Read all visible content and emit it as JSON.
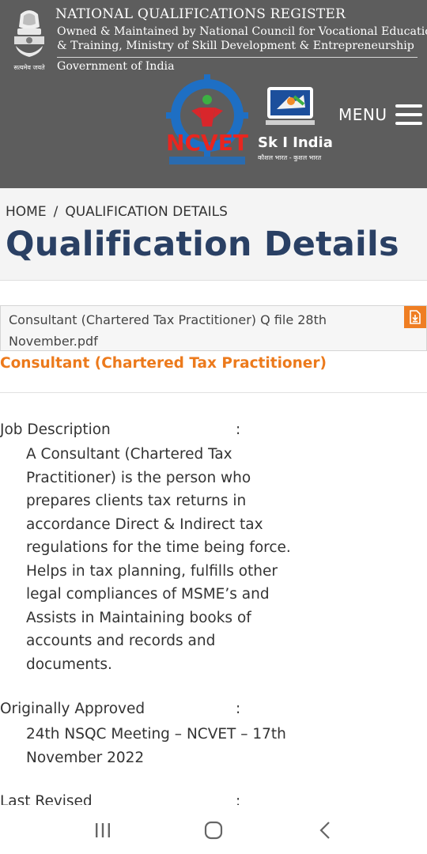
{
  "header": {
    "title": "NATIONAL QUALIFICATIONS REGISTER",
    "subtitle_line1": "Owned & Maintained by National Council for Vocational Education",
    "subtitle_line2": "& Training, Ministry of Skill Development & Entrepreneurship",
    "government": "Government of India",
    "emblem_caption": "सत्यमेव जयते",
    "ncvet_logo_text": "NCVET",
    "skill_india_text": "Sk I India",
    "skill_india_tagline": "कौशल भारत - कुशल भारत",
    "menu_label": "MENU"
  },
  "breadcrumb": {
    "home": "HOME",
    "separator": "/",
    "current": "QUALIFICATION DETAILS"
  },
  "page_title": "Qualification Details",
  "file": {
    "name": "Consultant (Chartered Tax Practitioner) Q file 28th November.pdf",
    "icon": "pdf-download-icon"
  },
  "qualification_title": "Consultant (Chartered Tax Practitioner)",
  "details": [
    {
      "label": "Job Description",
      "colon": ":",
      "value": "A Consultant (Chartered Tax Practitioner) is the person who prepares clients tax returns in accordance Direct & Indirect tax regulations for the time being force. Helps in tax planning, fulfills other legal compliances of MSME’s and Assists in Maintaining books of accounts and records and documents."
    },
    {
      "label": "Originally Approved",
      "colon": ":",
      "value": "24th NSQC Meeting – NCVET – 17th November 2022"
    },
    {
      "label": "Last Revised",
      "colon": ":"
    }
  ],
  "nav": {
    "recent_icon": "recent-apps-icon",
    "home_icon": "home-circle-icon",
    "back_icon": "back-chevron-icon"
  },
  "colors": {
    "header_bg": "#5d5d5d",
    "title_blue": "#2a4064",
    "accent_orange": "#ec7a1c"
  }
}
